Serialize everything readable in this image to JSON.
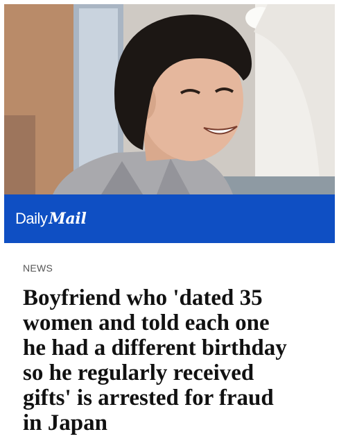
{
  "brand": {
    "daily": "Daily",
    "mail": "Mail",
    "bar_color": "#0f4fc3"
  },
  "article": {
    "section": "NEWS",
    "headline_lines": [
      "Boyfriend who 'dated 35",
      "women and told each one",
      "he had a different birthday",
      "so he regularly received",
      "gifts' is arrested for fraud",
      "in Japan"
    ]
  },
  "image": {
    "subject": "smiling young man with dark hair in grey jacket"
  }
}
